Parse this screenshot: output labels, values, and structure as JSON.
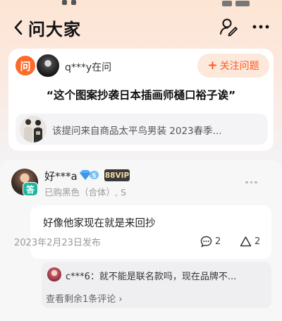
{
  "nav": {
    "title": "问大家"
  },
  "question": {
    "ask_badge": "问",
    "asker_text": "q***y在问",
    "follow_label": "关注问题",
    "follow_plus": "+",
    "text": "“这个图案抄袭日本插画师樋口裕子诶”",
    "product_text": "该提问来自商品太平鸟男装 2023春季..."
  },
  "answer": {
    "badge": "答",
    "user_name": "好***a",
    "level": "5",
    "vip": "88VIP",
    "purchase_info": "已购黑色（合体）, S",
    "content": "好像他家现在就是来回抄",
    "date": "2023年2月23日发布",
    "comment_count": "2",
    "like_count": "2",
    "reply_text": "c***6：就不能是联名款吗，现在品牌不...",
    "view_more": "查看剩余1条评论 ›"
  },
  "colors": {
    "accent": "#ff5a1f",
    "ask_badge": "#ff6a2b",
    "answer_badge": "#1fb6a0",
    "vip_bg": "#3a3a3a",
    "vip_text": "#f4d9a6",
    "diamond": "#5ab0f5"
  },
  "icons": {
    "back": "chevron-left-icon",
    "user_edit": "user-edit-icon",
    "more": "more-dots-icon",
    "comment": "comment-bubble-icon",
    "like": "triangle-like-icon",
    "diamond": "diamond-level-icon"
  }
}
